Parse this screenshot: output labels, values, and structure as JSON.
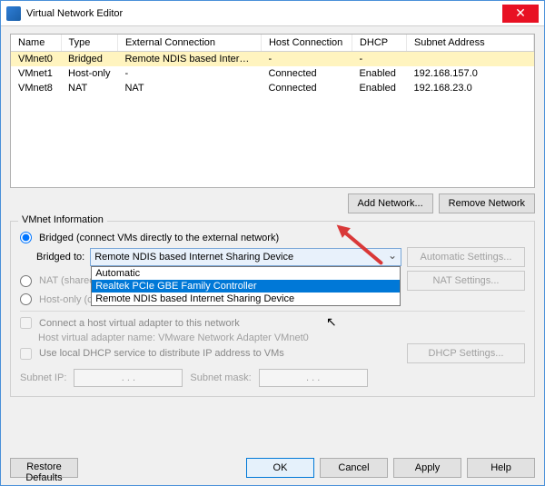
{
  "title": "Virtual Network Editor",
  "table": {
    "headers": [
      "Name",
      "Type",
      "External Connection",
      "Host Connection",
      "DHCP",
      "Subnet Address"
    ],
    "rows": [
      {
        "name": "VMnet0",
        "type": "Bridged",
        "ext": "Remote NDIS based Interne...",
        "host": "-",
        "dhcp": "-",
        "subnet": ""
      },
      {
        "name": "VMnet1",
        "type": "Host-only",
        "ext": "-",
        "host": "Connected",
        "dhcp": "Enabled",
        "subnet": "192.168.157.0"
      },
      {
        "name": "VMnet8",
        "type": "NAT",
        "ext": "NAT",
        "host": "Connected",
        "dhcp": "Enabled",
        "subnet": "192.168.23.0"
      }
    ]
  },
  "buttons": {
    "add_network": "Add Network...",
    "remove_network": "Remove Network",
    "auto_settings": "Automatic Settings...",
    "nat_settings": "NAT Settings...",
    "dhcp_settings": "DHCP Settings...",
    "restore": "Restore Defaults",
    "ok": "OK",
    "cancel": "Cancel",
    "apply": "Apply",
    "help": "Help"
  },
  "group": {
    "title": "VMnet Information",
    "bridged_label": "Bridged (connect VMs directly to the external network)",
    "bridged_to": "Bridged to:",
    "selected": "Remote NDIS based Internet Sharing Device",
    "options": [
      "Automatic",
      "Realtek PCIe GBE Family Controller",
      "Remote NDIS based Internet Sharing Device"
    ],
    "nat_label": "NAT (shared host's IP address with VMs)",
    "hostonly_label": "Host-only (connect VMs internally in a private network)",
    "connect_adapter": "Connect a host virtual adapter to this network",
    "adapter_name": "Host virtual adapter name: VMware Network Adapter VMnet0",
    "use_dhcp": "Use local DHCP service to distribute IP address to VMs",
    "subnet_ip": "Subnet IP:",
    "subnet_mask": "Subnet mask:",
    "ip_dots": ".       .       ."
  }
}
